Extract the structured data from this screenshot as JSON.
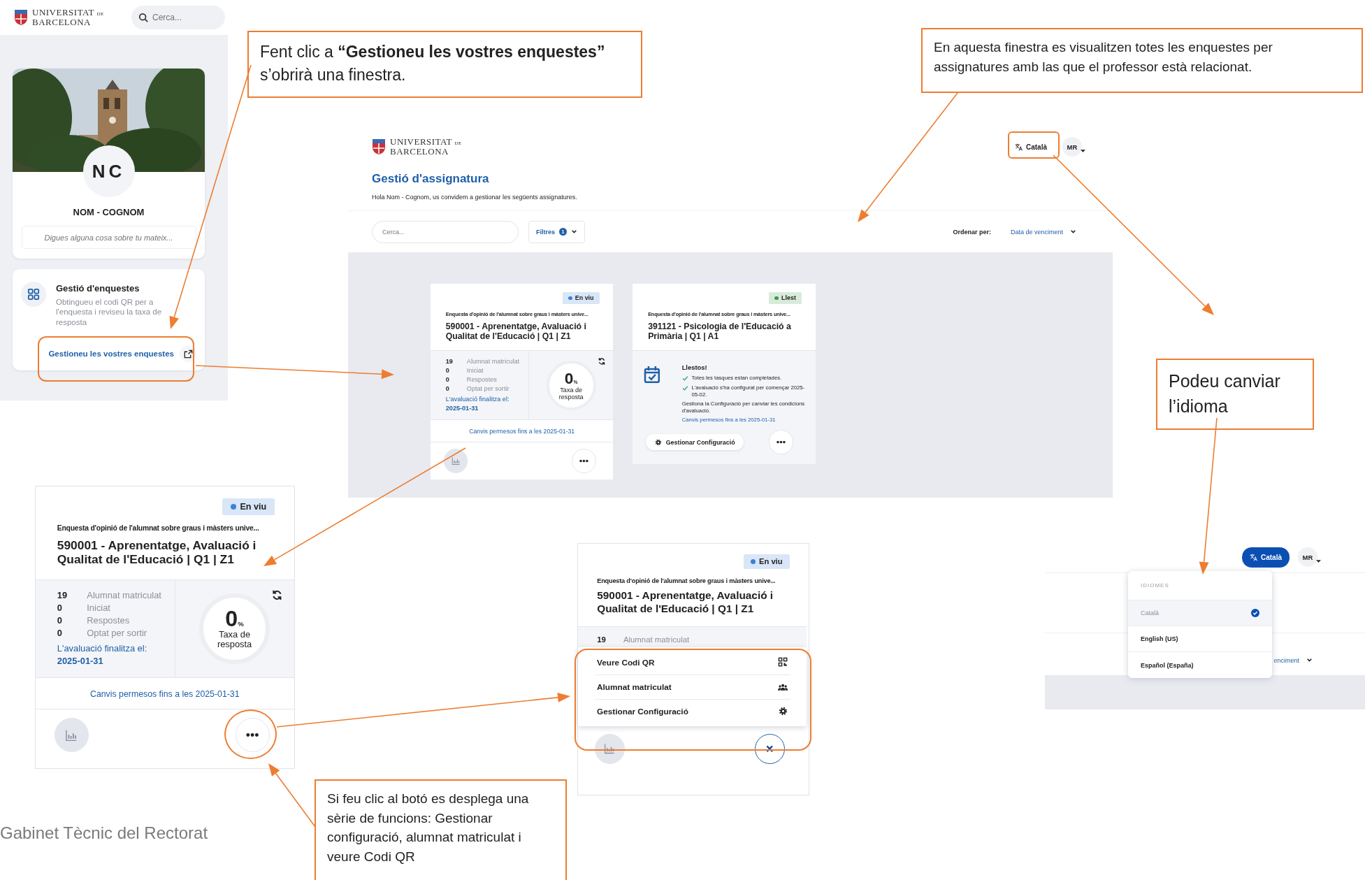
{
  "left_panel": {
    "logo": {
      "line_1": "UNIVERSITAT",
      "line_1_suffix": "DE",
      "line_2": "BARCELONA"
    },
    "search": {
      "placeholder": "Cerca..."
    },
    "profile": {
      "initials": "NC",
      "name": "NOM - COGNOM",
      "bio": {
        "placeholder": "Digues alguna cosa sobre tu mateix..."
      }
    },
    "tool_card": {
      "title": "Gestió d'enquestes",
      "description": "Obtingueu el codi QR per a l'enquesta i reviseu la taxa de resposta",
      "link": "Gestioneu les vostres enquestes"
    }
  },
  "callouts": [
    {
      "text": "Fent clic a **“Gestioneu les vostres enquestes”** s’obrirà una finestra."
    },
    {
      "text": "En aquesta finestra es visualitzen totes les enquestes per assignatures amb las que el professor està relacionat."
    },
    {
      "text": "Podeu canviar l’idioma"
    },
    {
      "text": "Si feu clic al botó es desplega una sèrie de funcions: Gestionar configuració, alumnat matriculat i veure Codi QR"
    }
  ],
  "main_screen": {
    "logo": {
      "line_1": "UNIVERSITAT",
      "line_1_suffix": "DE",
      "line_2": "BARCELONA"
    },
    "language_button": {
      "label": "Català",
      "open": false
    },
    "avatar": "MR",
    "title": "Gestió d'assignatura",
    "greeting": "Hola Nom - Cognom, us convidem a gestionar les següents assignatures.",
    "search": {
      "placeholder": "Cerca..."
    },
    "filter": {
      "label": "Filtres",
      "count": "1"
    },
    "sort": {
      "label": "Ordenar per:",
      "value": "Data de venciment"
    },
    "cards": [
      {
        "kind": "stats",
        "status": {
          "label": "En viu",
          "color": "#3b82d6"
        },
        "survey": "Enquesta d'opinió de l'alumnat sobre graus i màsters unive...",
        "title": "590001 - Aprenentatge, Avaluació i Qualitat de l'Educació | Q1 | Z1",
        "stats": [
          {
            "value": "19",
            "label": "Alumnat matriculat"
          },
          {
            "value": "0",
            "label": "Iniciat"
          },
          {
            "value": "0",
            "label": "Respostes"
          },
          {
            "value": "0",
            "label": "Optat per sortir"
          }
        ],
        "end_label": "L'avaluació finalitza el:",
        "end_date": "2025-01-31",
        "rate": "0",
        "rate_unit": "%",
        "rate_label": "Taxa de resposta",
        "changes": "Canvis permesos fins a les 2025-01-31"
      },
      {
        "kind": "ready",
        "status": {
          "label": "Llest",
          "color": "#3a9a4a"
        },
        "survey": "Enquesta d'opinió de l'alumnat sobre graus i màsters unive...",
        "title": "391121 - Psicologia de l'Educació a Primària | Q1 | A1",
        "ready_title": "Llestos!",
        "checks": [
          "Totes les tasques estan completades.",
          "L'avaluació s'ha configurat per començar 2025-05-02."
        ],
        "note": "Gestiona la Configuració per canviar les condicions d'avaluació.",
        "changes": "Canvis permesos fins a les 2025-01-31",
        "config_button": "Gestionar Configuració"
      }
    ]
  },
  "zoomed_card": {
    "kind": "stats",
    "status": {
      "label": "En viu",
      "color": "#3b82d6"
    },
    "survey": "Enquesta d'opinió de l'alumnat sobre graus i màsters unive...",
    "title": "590001 - Aprenentatge, Avaluació i Qualitat de l'Educació | Q1 | Z1",
    "stats": [
      {
        "value": "19",
        "label": "Alumnat matriculat"
      },
      {
        "value": "0",
        "label": "Iniciat"
      },
      {
        "value": "0",
        "label": "Respostes"
      },
      {
        "value": "0",
        "label": "Optat per sortir"
      }
    ],
    "end_label": "L'avaluació finalitza el:",
    "end_date": "2025-01-31",
    "rate": "0",
    "rate_unit": "%",
    "rate_label": "Taxa de resposta",
    "changes": "Canvis permesos fins a les 2025-01-31"
  },
  "menu_card": {
    "kind": "menu",
    "status": {
      "label": "En viu",
      "color": "#3b82d6"
    },
    "survey": "Enquesta d'opinió de l'alumnat sobre graus i màsters unive...",
    "title": "590001 - Aprenentatge, Avaluació i Qualitat de l'Educació | Q1 | Z1",
    "stats": [
      {
        "value": "19",
        "label": "Alumnat matriculat"
      }
    ],
    "menu": [
      {
        "label": "Veure Codi QR",
        "kind": "qr"
      },
      {
        "label": "Alumnat matriculat",
        "kind": "people"
      },
      {
        "label": "Gestionar Configuració",
        "kind": "settings"
      }
    ]
  },
  "language_panel": {
    "language_button": {
      "label": "Català",
      "open": true
    },
    "avatar": "MR",
    "heading": "IDIOMES",
    "options": [
      {
        "label": "Català",
        "selected": true
      },
      {
        "label": "English (US)",
        "selected": false
      },
      {
        "label": "Español (España)",
        "selected": false
      }
    ],
    "sort_value_fragment": "enciment"
  },
  "footer": "Gabinet Tècnic del Rectorat"
}
